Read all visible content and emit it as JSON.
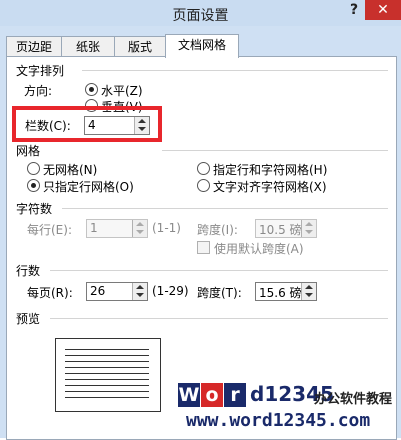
{
  "window": {
    "title": "页面设置",
    "help": "?",
    "close": "✕"
  },
  "tabs": [
    {
      "label": "页边距"
    },
    {
      "label": "纸张"
    },
    {
      "label": "版式"
    },
    {
      "label": "文档网格"
    }
  ],
  "text_direction": {
    "group_label": "文字排列",
    "direction_label": "方向:",
    "horizontal": "水平(Z)",
    "vertical": "垂直(V)",
    "columns_label": "栏数(C):",
    "columns_value": "4"
  },
  "grid": {
    "group_label": "网格",
    "no_grid": "无网格(N)",
    "specify_line_char": "指定行和字符网格(H)",
    "specify_line_only": "只指定行网格(O)",
    "snap_to_char": "文字对齐字符网格(X)"
  },
  "chars": {
    "group_label": "字符数",
    "per_line_label": "每行(E):",
    "per_line_value": "1",
    "per_line_range": "(1-1)",
    "pitch_label": "跨度(I):",
    "pitch_value": "10.5 磅",
    "default_pitch": "使用默认跨度(A)"
  },
  "lines": {
    "group_label": "行数",
    "per_page_label": "每页(R):",
    "per_page_value": "26",
    "per_page_range": "(1-29)",
    "pitch_label": "跨度(T):",
    "pitch_value": "15.6 磅"
  },
  "preview": {
    "group_label": "预览"
  },
  "watermark": {
    "boxes": [
      "W",
      "o",
      "r",
      "d"
    ],
    "rest": "12345",
    "suffix": "办公软件教程",
    "url": "www.word12345.com"
  }
}
